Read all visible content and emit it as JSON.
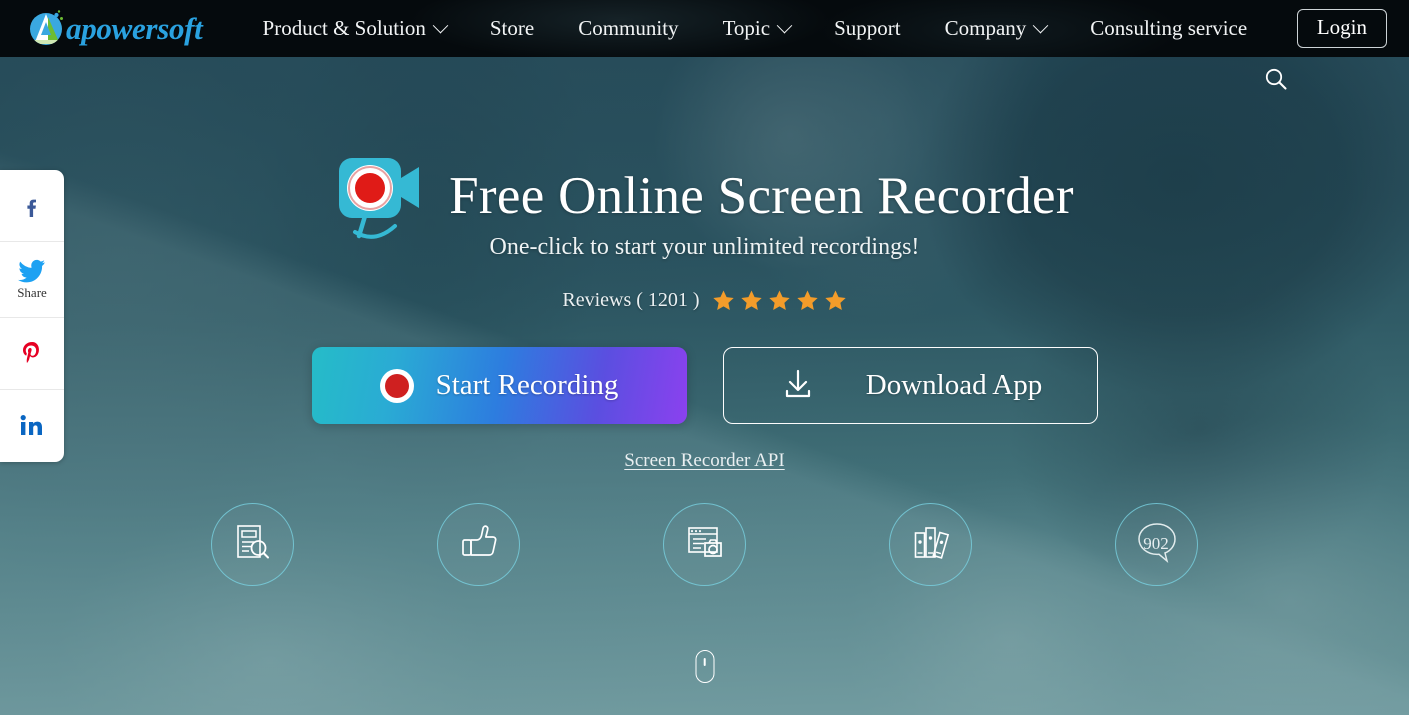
{
  "brand": {
    "name": "apowersoft",
    "logo_icon": "apowersoft-logo-icon",
    "logo_color": "#2aa2e0"
  },
  "nav": {
    "items": [
      {
        "label": "Product & Solution",
        "has_dropdown": true
      },
      {
        "label": "Store",
        "has_dropdown": false
      },
      {
        "label": "Community",
        "has_dropdown": false
      },
      {
        "label": "Topic",
        "has_dropdown": true
      },
      {
        "label": "Support",
        "has_dropdown": false
      },
      {
        "label": "Company",
        "has_dropdown": true
      },
      {
        "label": "Consulting service",
        "has_dropdown": false
      }
    ],
    "login_label": "Login",
    "background_color": "#050a0d"
  },
  "search": {
    "icon": "search-icon"
  },
  "share_rail": {
    "items": [
      {
        "icon": "facebook-icon",
        "label": "",
        "color": "#3b5998"
      },
      {
        "icon": "twitter-icon",
        "label": "Share",
        "color": "#1da1f2"
      },
      {
        "icon": "pinterest-icon",
        "label": "",
        "color": "#e60023"
      },
      {
        "icon": "linkedin-icon",
        "label": "",
        "color": "#0a66c2"
      }
    ]
  },
  "hero": {
    "icon": "video-camera-record-icon",
    "title": "Free Online Screen Recorder",
    "subtitle": "One-click to start your unlimited recordings!",
    "reviews_text": "Reviews ( 1201 )",
    "reviews_count": 1201,
    "star_count": 5,
    "star_color": "#f39c2a",
    "primary_button": {
      "label": "Start Recording",
      "icon": "record-dot-icon",
      "gradient_from": "#25bcc8",
      "gradient_to": "#8b41ef"
    },
    "secondary_button": {
      "label": "Download App",
      "icon": "download-icon"
    },
    "api_link": "Screen Recorder API",
    "overlay_color": "#2b5564"
  },
  "features": [
    {
      "icon": "document-search-icon",
      "value": ""
    },
    {
      "icon": "thumbs-up-icon",
      "value": ""
    },
    {
      "icon": "browser-camera-icon",
      "value": ""
    },
    {
      "icon": "books-icon",
      "value": ""
    },
    {
      "icon": "speech-bubble-icon",
      "value": "902"
    }
  ],
  "scroll_hint": {
    "icon": "mouse-scroll-icon"
  }
}
